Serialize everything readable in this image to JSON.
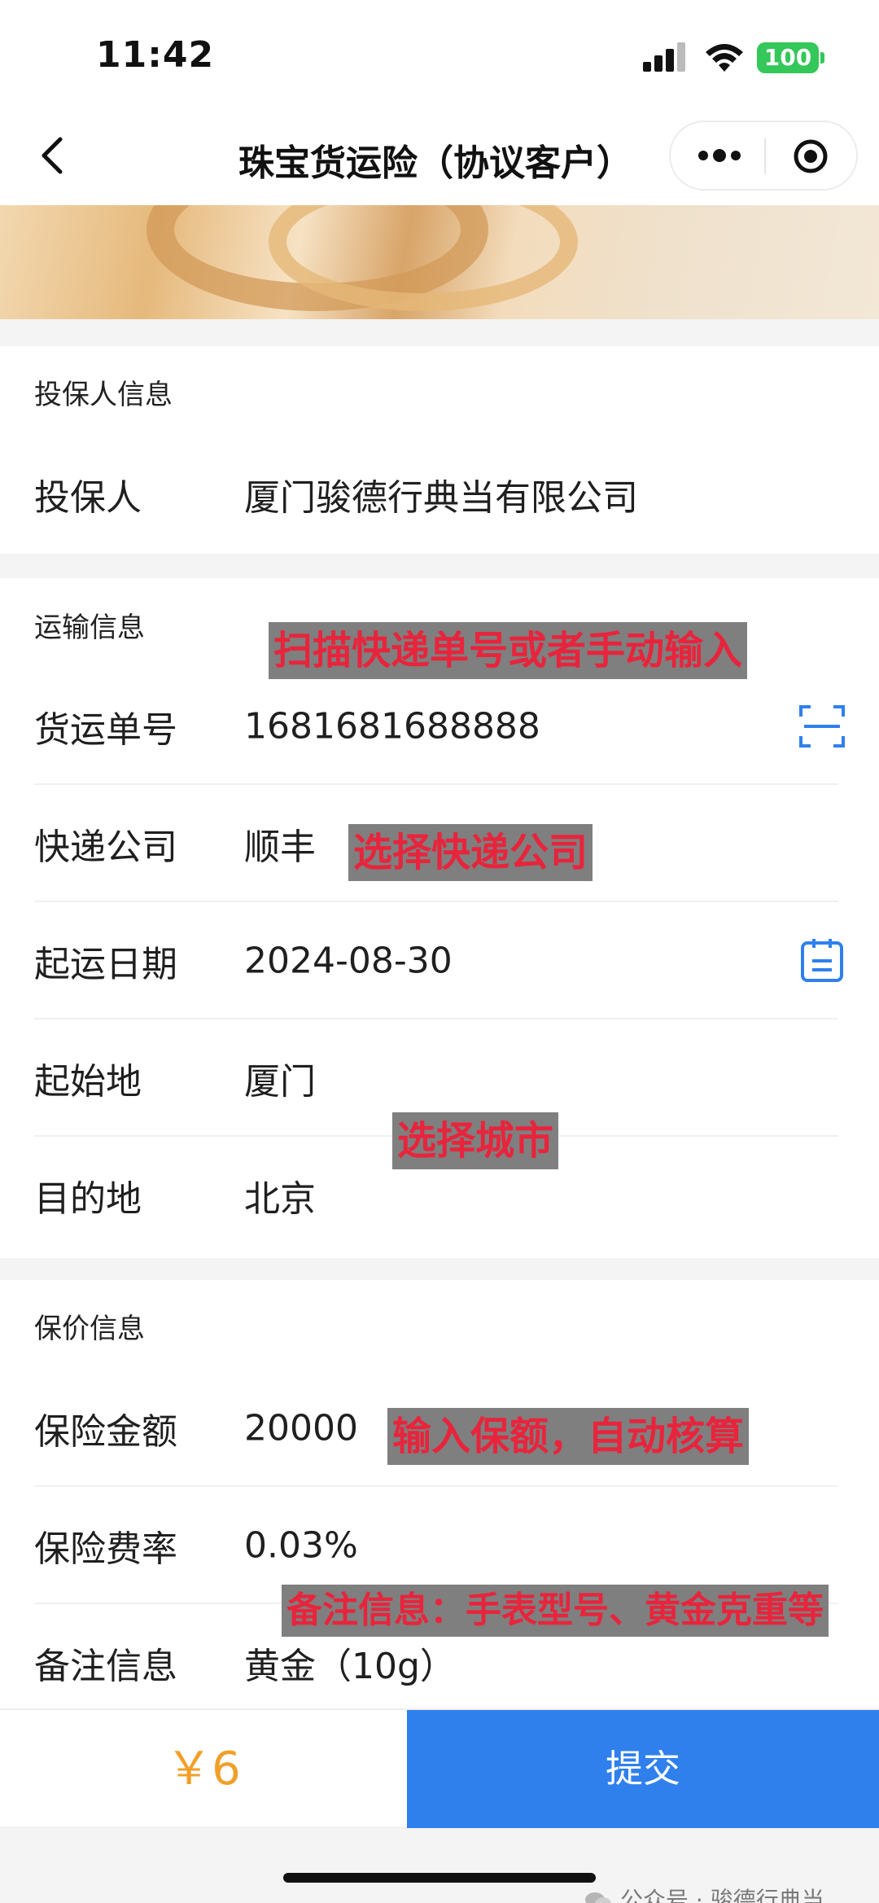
{
  "status_bar": {
    "time": "11:42",
    "battery": "100"
  },
  "nav": {
    "title": "珠宝货运险（协议客户）"
  },
  "applicant_section": {
    "heading": "投保人信息",
    "rows": [
      {
        "label": "投保人",
        "value": "厦门骏德行典当有限公司"
      }
    ]
  },
  "transport_section": {
    "heading": "运输信息",
    "rows": [
      {
        "label": "货运单号",
        "value": "1681681688888",
        "icon": "scan-icon"
      },
      {
        "label": "快递公司",
        "value": "顺丰"
      },
      {
        "label": "起运日期",
        "value": "2024-08-30",
        "icon": "calendar-icon"
      },
      {
        "label": "起始地",
        "value": "厦门"
      },
      {
        "label": "目的地",
        "value": "北京"
      }
    ]
  },
  "insured_section": {
    "heading": "保价信息",
    "rows": [
      {
        "label": "保险金额",
        "value": "20000"
      },
      {
        "label": "保险费率",
        "value": "0.03%"
      },
      {
        "label": "备注信息",
        "value": "黄金（10g）"
      }
    ]
  },
  "annotations": {
    "scan": "扫描快递单号或者手动输入",
    "courier": "选择快递公司",
    "city": "选择城市",
    "amount": "输入保额，自动核算",
    "remark": "备注信息：手表型号、黄金克重等"
  },
  "footer": {
    "price": "￥6",
    "submit_label": "提交"
  },
  "watermark": {
    "text": "公众号 · 骏德行典当"
  },
  "colors": {
    "accent": "#2f80ed",
    "price": "#f0a02a",
    "annotation_text": "#e8243c",
    "annotation_bg": "#7f7f7f",
    "battery": "#34c759"
  }
}
